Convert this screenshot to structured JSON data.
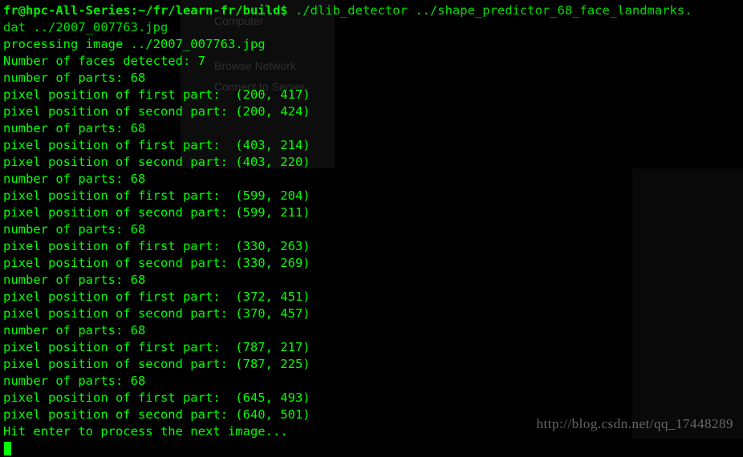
{
  "prompt": "fr@hpc-All-Series:~/fr/learn-fr/build$",
  "command": "./dlib_detector ../shape_predictor_68_face_landmarks.",
  "command2": "dat ../2007_007763.jpg",
  "lines": [
    "processing image ../2007_007763.jpg",
    "Number of faces detected: 7",
    "number of parts: 68",
    "pixel position of first part:  (200, 417)",
    "pixel position of second part: (200, 424)",
    "number of parts: 68",
    "pixel position of first part:  (403, 214)",
    "pixel position of second part: (403, 220)",
    "number of parts: 68",
    "pixel position of first part:  (599, 204)",
    "pixel position of second part: (599, 211)",
    "number of parts: 68",
    "pixel position of first part:  (330, 263)",
    "pixel position of second part: (330, 269)",
    "number of parts: 68",
    "pixel position of first part:  (372, 451)",
    "pixel position of second part: (370, 457)",
    "number of parts: 68",
    "pixel position of first part:  (787, 217)",
    "pixel position of second part: (787, 225)",
    "number of parts: 68",
    "pixel position of first part:  (645, 493)",
    "pixel position of second part: (640, 501)",
    "Hit enter to process the next image..."
  ],
  "bg_items": {
    "computer": "Computer",
    "network": "Browse Network",
    "connect": "Connect to Server"
  },
  "watermark": "http://blog.csdn.net/qq_17448289"
}
